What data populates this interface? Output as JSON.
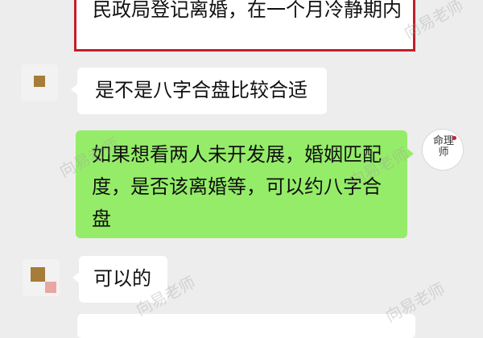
{
  "top_message": {
    "text": "民政局登记离婚，在一个月冷静期内"
  },
  "messages": [
    {
      "side": "left",
      "text": "是不是八字合盘比较合适"
    },
    {
      "side": "right",
      "text": "如果想看两人未开发展，婚姻匹配度，是否该离婚等，可以约八字合盘"
    },
    {
      "side": "left",
      "text": "可以的"
    }
  ],
  "advisor_avatar": {
    "glyphs": "命理师"
  },
  "watermark": {
    "text": "向易老师"
  },
  "colors": {
    "background": "#ededed",
    "incoming_bubble": "#ffffff",
    "outgoing_bubble": "#95ec69",
    "highlight_border": "#c0202a",
    "avatar_gold": "#a67c3a",
    "avatar_pink": "#e9a6a6"
  }
}
